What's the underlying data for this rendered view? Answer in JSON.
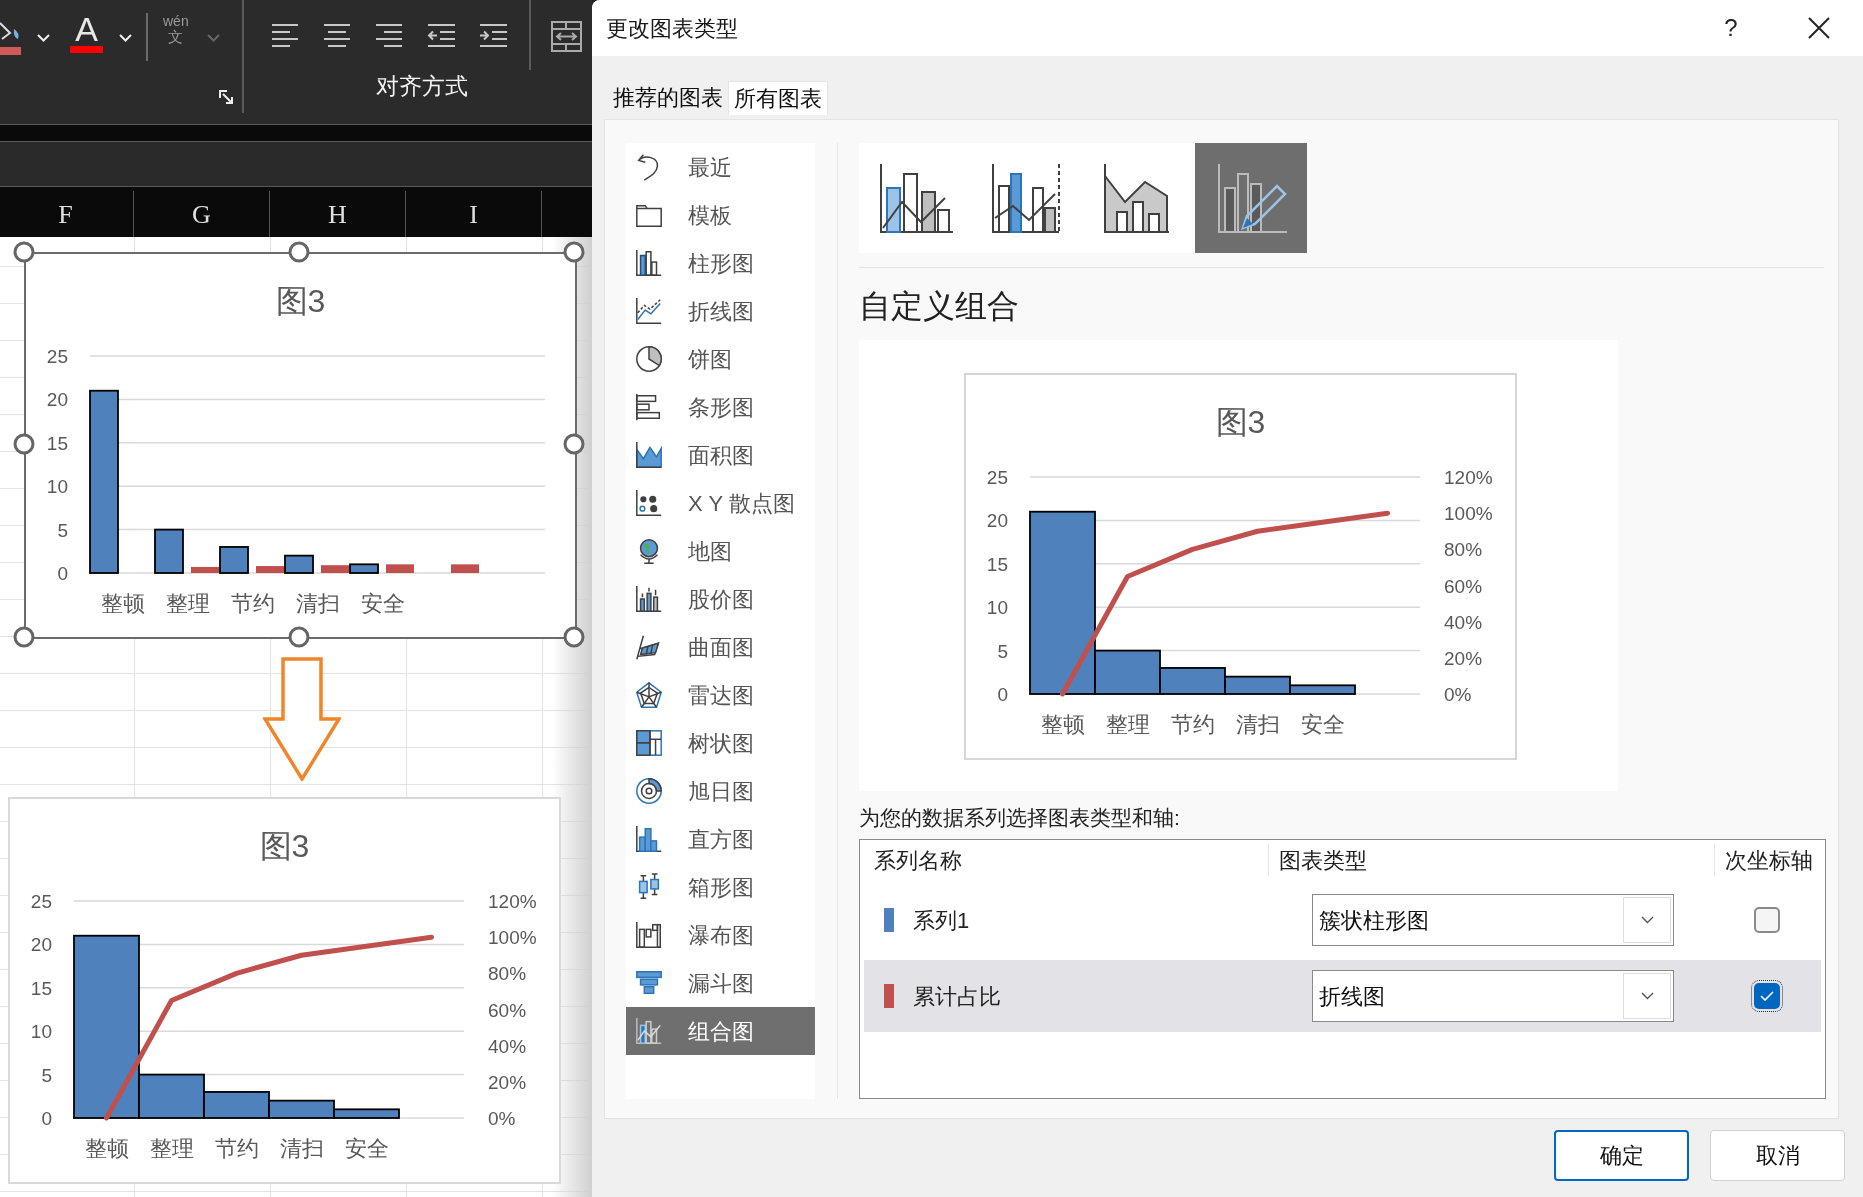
{
  "ribbon": {
    "font_color_glyph": "A",
    "phonetic_guide": {
      "pinyin": "wén",
      "character": "文"
    },
    "group_label": "对齐方式"
  },
  "column_headers": [
    "F",
    "G",
    "H",
    "I"
  ],
  "sheet_charts": [
    {
      "selected": true,
      "chart_data": {
        "type": "bar",
        "title": "图3",
        "grid": true,
        "categories": [
          "整顿",
          "整理",
          "节约",
          "清扫",
          "安全",
          null
        ],
        "series": [
          {
            "color": "#4f81bd",
            "values": [
              21,
              5,
              3,
              2,
              1,
              null
            ]
          },
          {
            "color": "#c0504d",
            "values": [
              0,
              0.7,
              0.8,
              0.9,
              1,
              1
            ]
          }
        ],
        "ylim": [
          0,
          25
        ],
        "yticks": [
          0,
          5,
          10,
          15,
          20,
          25
        ]
      }
    },
    {
      "selected": false,
      "chart_data": {
        "type": "bar",
        "title": "图3",
        "grid": true,
        "categories": [
          "整顿",
          "整理",
          "节约",
          "清扫",
          "安全",
          null
        ],
        "series": [
          {
            "color": "#4f81bd",
            "values": [
              21,
              5,
              3,
              2,
              1,
              null
            ]
          },
          {
            "color": "#c0504d",
            "type": "line",
            "axis": "y2",
            "values": [
              0,
              0.65,
              0.8,
              0.9,
              0.95,
              1
            ]
          }
        ],
        "ylim": [
          0,
          25
        ],
        "yticks": [
          0,
          5,
          10,
          15,
          20,
          25
        ],
        "y2lim": [
          0,
          1.2
        ],
        "y2ticks": [
          {
            "value": 0,
            "label": "0%"
          },
          {
            "value": 0.2,
            "label": "20%"
          },
          {
            "value": 0.4,
            "label": "40%"
          },
          {
            "value": 0.6,
            "label": "60%"
          },
          {
            "value": 0.8,
            "label": "80%"
          },
          {
            "value": 1.0,
            "label": "100%"
          },
          {
            "value": 1.2,
            "label": "120%"
          }
        ]
      }
    }
  ],
  "dialog": {
    "title": "更改图表类型",
    "help_label": "?",
    "tabs": [
      {
        "label": "推荐的图表",
        "selected": false
      },
      {
        "label": "所有图表",
        "selected": true
      }
    ],
    "chart_types": [
      {
        "kind": "recent",
        "label": "最近",
        "selected": false
      },
      {
        "kind": "templates",
        "label": "模板",
        "selected": false
      },
      {
        "kind": "column",
        "label": "柱形图",
        "selected": false
      },
      {
        "kind": "line",
        "label": "折线图",
        "selected": false
      },
      {
        "kind": "pie",
        "label": "饼图",
        "selected": false
      },
      {
        "kind": "bar",
        "label": "条形图",
        "selected": false
      },
      {
        "kind": "area",
        "label": "面积图",
        "selected": false
      },
      {
        "kind": "scatter",
        "label": "X Y 散点图",
        "selected": false
      },
      {
        "kind": "map",
        "label": "地图",
        "selected": false
      },
      {
        "kind": "stock",
        "label": "股价图",
        "selected": false
      },
      {
        "kind": "surface",
        "label": "曲面图",
        "selected": false
      },
      {
        "kind": "radar",
        "label": "雷达图",
        "selected": false
      },
      {
        "kind": "treemap",
        "label": "树状图",
        "selected": false
      },
      {
        "kind": "sunburst",
        "label": "旭日图",
        "selected": false
      },
      {
        "kind": "histogram",
        "label": "直方图",
        "selected": false
      },
      {
        "kind": "box",
        "label": "箱形图",
        "selected": false
      },
      {
        "kind": "waterfall",
        "label": "瀑布图",
        "selected": false
      },
      {
        "kind": "funnel",
        "label": "漏斗图",
        "selected": false
      },
      {
        "kind": "combo",
        "label": "组合图",
        "selected": true
      }
    ],
    "subtypes": [
      {
        "kind": "column-line",
        "selected": false
      },
      {
        "kind": "column-line-secondary",
        "selected": false
      },
      {
        "kind": "area-column",
        "selected": false
      },
      {
        "kind": "custom",
        "selected": true
      }
    ],
    "heading": "自定义组合",
    "preview": {
      "chart_data": {
        "type": "bar",
        "title": "图3",
        "grid": true,
        "categories": [
          "整顿",
          "整理",
          "节约",
          "清扫",
          "安全",
          null
        ],
        "series": [
          {
            "color": "#4f81bd",
            "values": [
              21,
              5,
              3,
              2,
              1,
              null
            ]
          },
          {
            "color": "#c0504d",
            "type": "line",
            "axis": "y2",
            "values": [
              0,
              0.65,
              0.8,
              0.9,
              0.95,
              1
            ]
          }
        ],
        "ylim": [
          0,
          25
        ],
        "yticks": [
          0,
          5,
          10,
          15,
          20,
          25
        ],
        "y2lim": [
          0,
          1.2
        ],
        "y2ticks": [
          {
            "value": 0,
            "label": "0%"
          },
          {
            "value": 0.2,
            "label": "20%"
          },
          {
            "value": 0.4,
            "label": "40%"
          },
          {
            "value": 0.6,
            "label": "60%"
          },
          {
            "value": 0.8,
            "label": "80%"
          },
          {
            "value": 1.0,
            "label": "100%"
          },
          {
            "value": 1.2,
            "label": "120%"
          }
        ]
      }
    },
    "series_prompt": "为您的数据系列选择图表类型和轴:",
    "series_table": {
      "columns": [
        "系列名称",
        "图表类型",
        "次坐标轴"
      ],
      "rows": [
        {
          "color": "#4f81bd",
          "name": "系列1",
          "chart_type": "簇状柱形图",
          "secondary_axis": false,
          "selected": false
        },
        {
          "color": "#c0504d",
          "name": "累计占比",
          "chart_type": "折线图",
          "secondary_axis": true,
          "selected": true
        }
      ]
    },
    "buttons": [
      {
        "label": "确定",
        "default": true
      },
      {
        "label": "取消",
        "default": false
      }
    ]
  }
}
